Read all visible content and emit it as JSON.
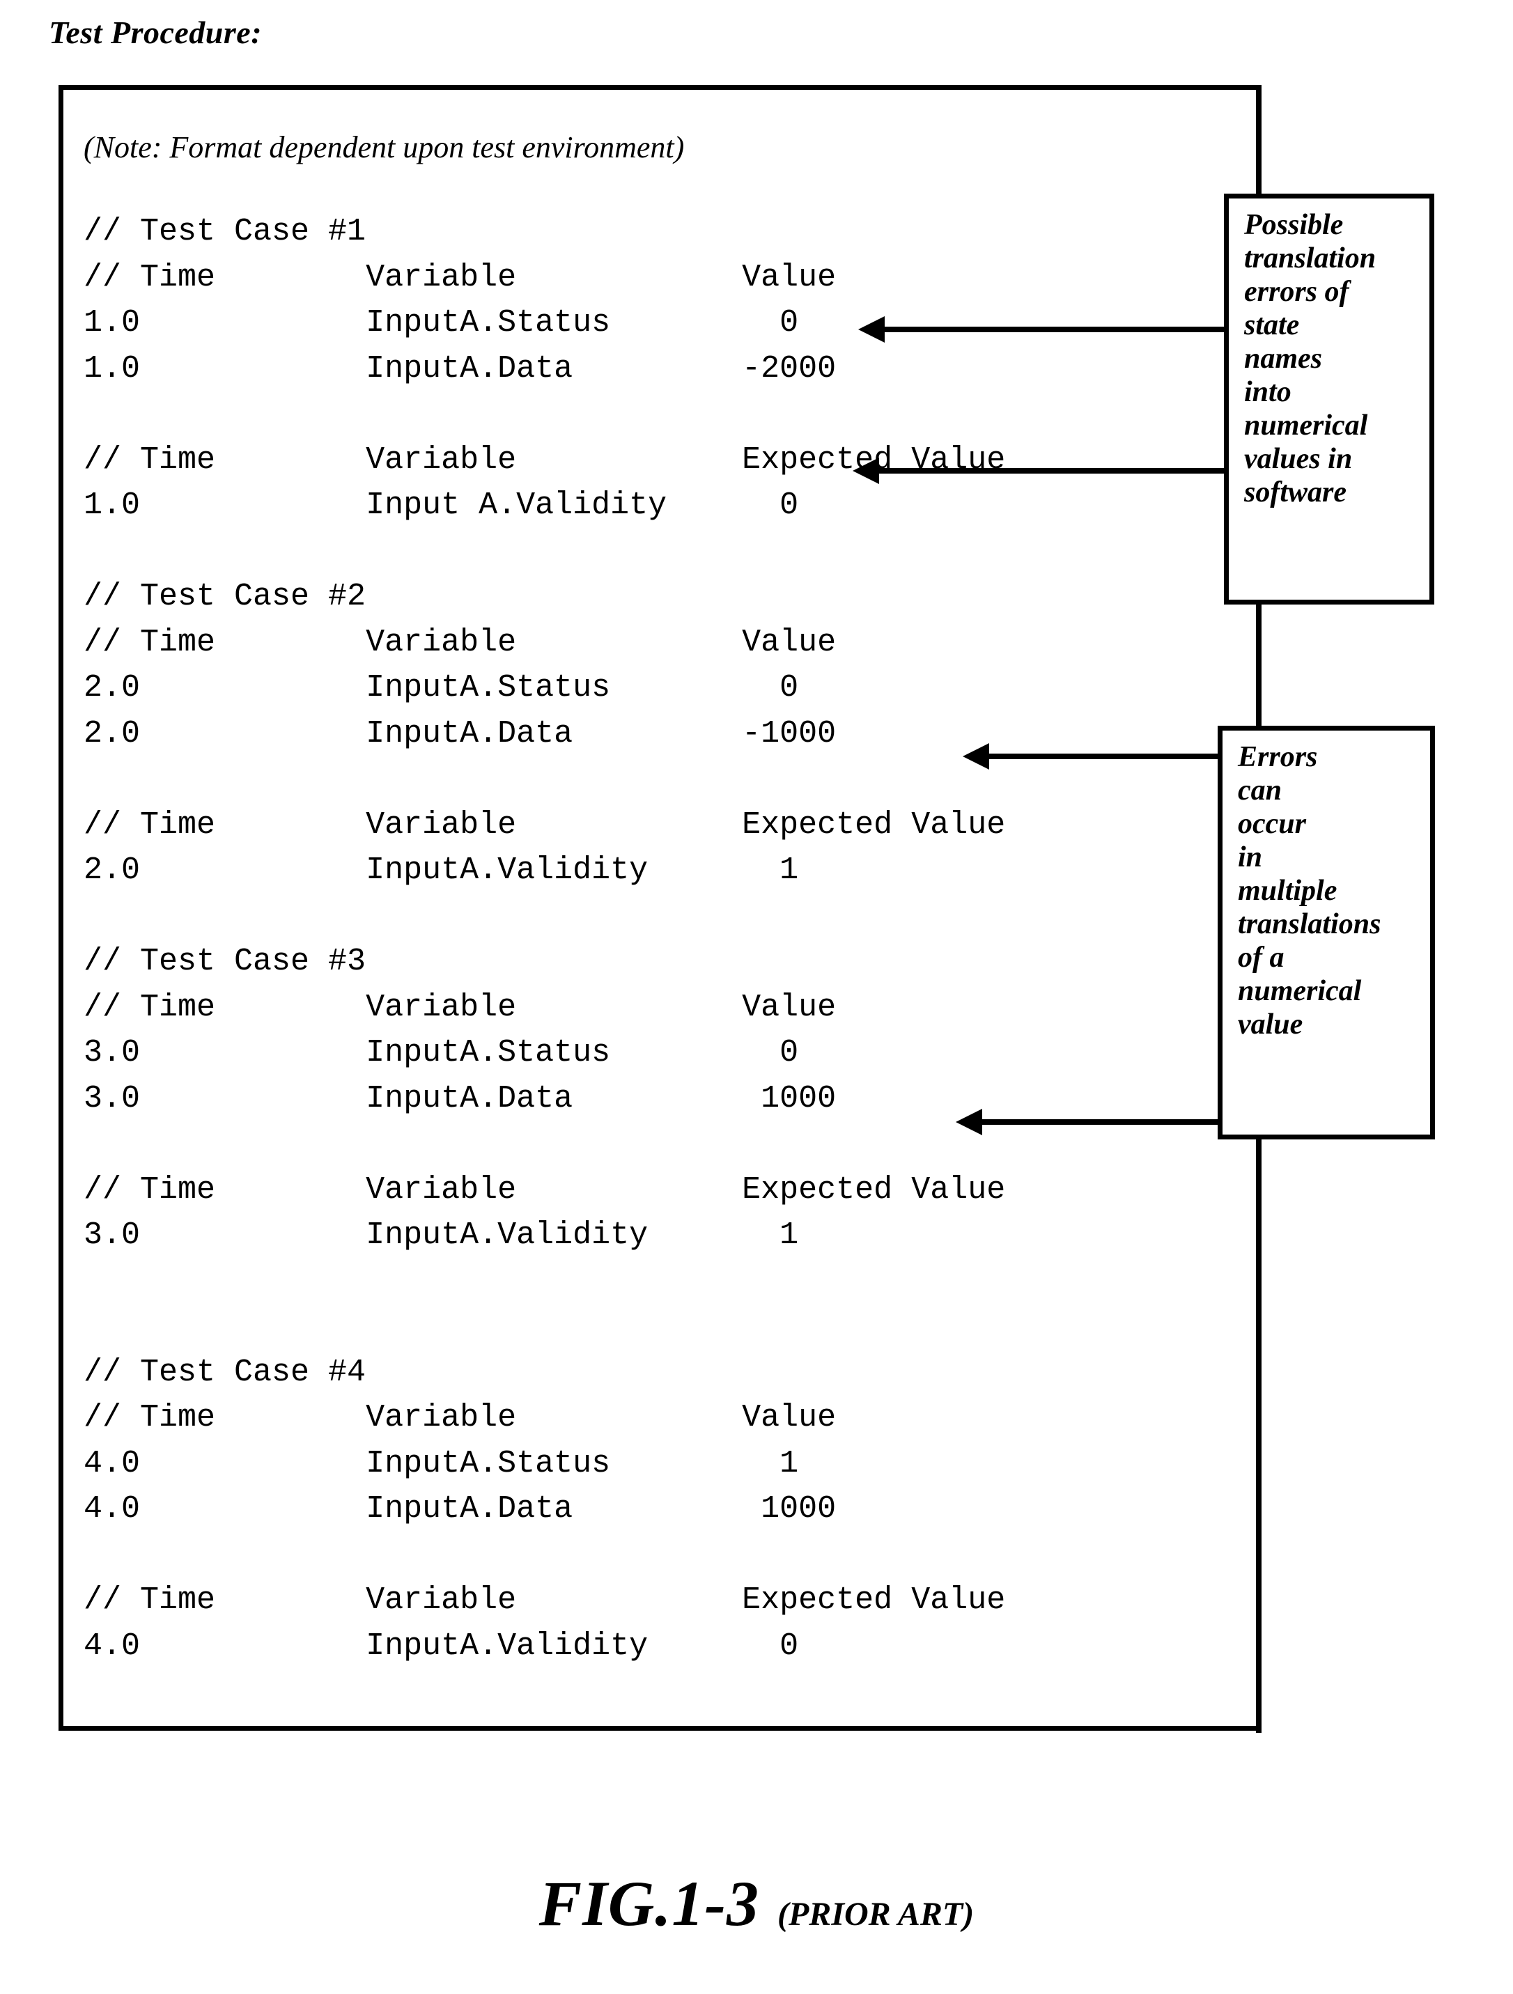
{
  "heading": "Test Procedure:",
  "note": "(Note: Format dependent upon test environment)",
  "code": {
    "lines": [
      "// Test Case #1",
      "// Time        Variable            Value",
      "1.0            InputA.Status         0",
      "1.0            InputA.Data         -2000",
      "",
      "// Time        Variable            Expected Value",
      "1.0            Input A.Validity      0",
      "",
      "// Test Case #2",
      "// Time        Variable            Value",
      "2.0            InputA.Status         0",
      "2.0            InputA.Data         -1000",
      "",
      "// Time        Variable            Expected Value",
      "2.0            InputA.Validity       1",
      "",
      "// Test Case #3",
      "// Time        Variable            Value",
      "3.0            InputA.Status         0",
      "3.0            InputA.Data          1000",
      "",
      "// Time        Variable            Expected Value",
      "3.0            InputA.Validity       1",
      "",
      "",
      "// Test Case #4",
      "// Time        Variable            Value",
      "4.0            InputA.Status         1",
      "4.0            InputA.Data          1000",
      "",
      "// Time        Variable            Expected Value",
      "4.0            InputA.Validity       0"
    ]
  },
  "callouts": [
    {
      "id": "translation-errors",
      "lines": [
        "Possible",
        "translation",
        "errors of",
        "state",
        "names",
        "into",
        "numerical",
        "values in",
        "software"
      ]
    },
    {
      "id": "multiple-translations",
      "lines": [
        "Errors",
        "can",
        "occur",
        "in",
        "multiple",
        "translations",
        "of a",
        "numerical",
        "value"
      ]
    }
  ],
  "figure": {
    "number": "FIG.1-3",
    "prior_art": "(PRIOR ART)"
  },
  "colors": {
    "ink": "#000000",
    "paper": "#ffffff"
  }
}
